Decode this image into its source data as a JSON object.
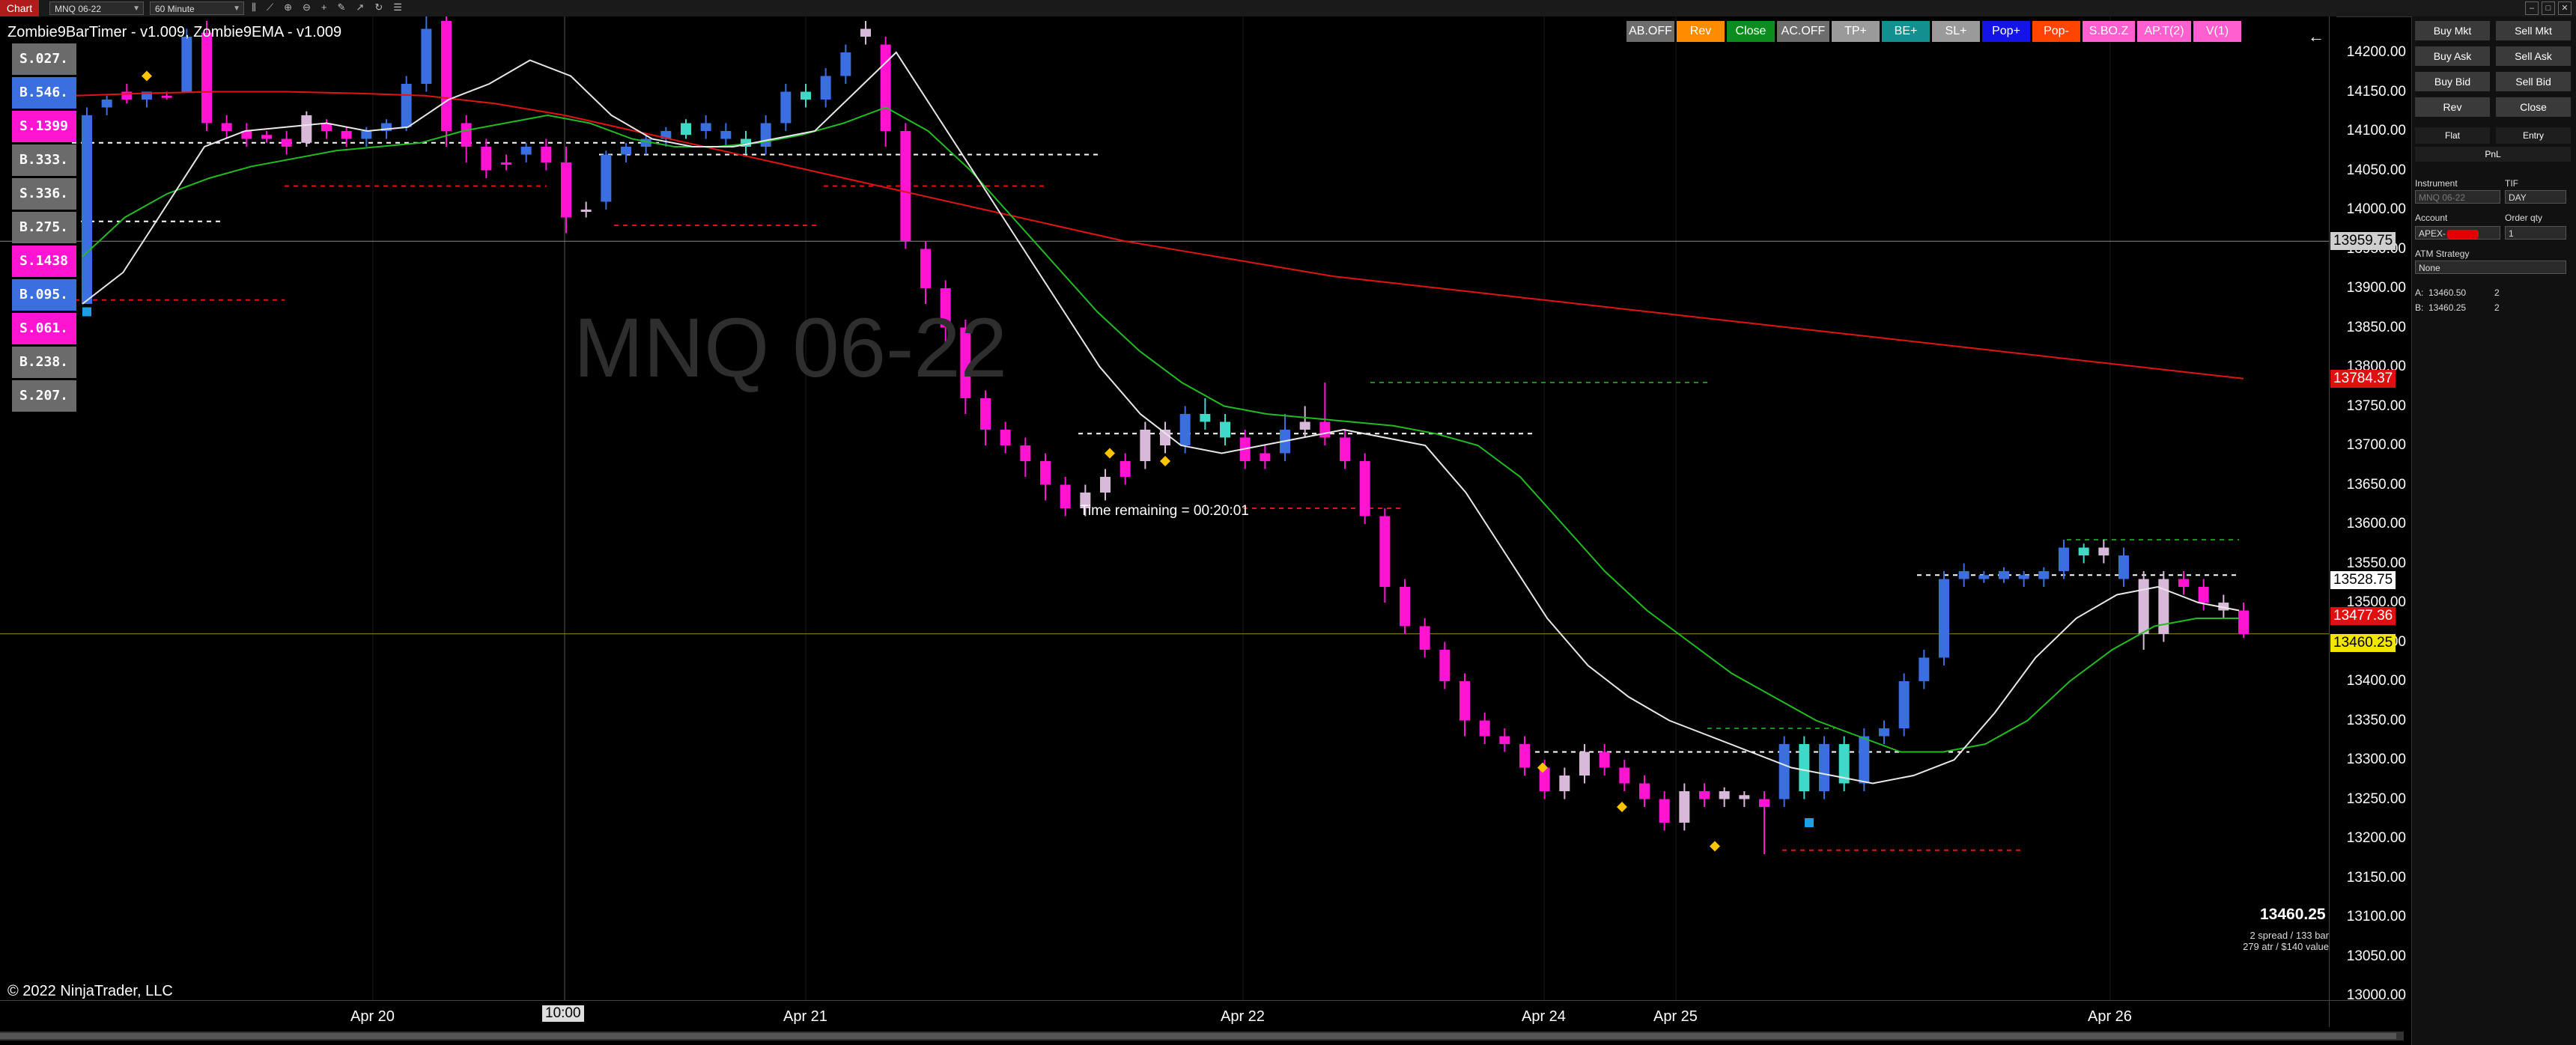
{
  "top_bar": {
    "chart_tab": "Chart",
    "instrument": "MNQ 06-22",
    "interval": "60 Minute",
    "icons": [
      "bar-style-icon",
      "indicators-icon",
      "zoom-icon",
      "magnify-icon",
      "crosshair-icon",
      "drawing-icon",
      "arrow-icon",
      "refresh-icon",
      "properties-icon"
    ]
  },
  "indicator_title": "Zombie9BarTimer - v1.009, Zombie9EMA - v1.009",
  "ladder": [
    {
      "label": "S.027.",
      "color": "#6b6b6b"
    },
    {
      "label": "B.546.",
      "color": "#3b6fe0"
    },
    {
      "label": "S.1399",
      "color": "#ff14d2"
    },
    {
      "label": "B.333.",
      "color": "#6b6b6b"
    },
    {
      "label": "S.336.",
      "color": "#6b6b6b"
    },
    {
      "label": "B.275.",
      "color": "#6b6b6b"
    },
    {
      "label": "S.1438",
      "color": "#ff14d2"
    },
    {
      "label": "B.095.",
      "color": "#3b6fe0"
    },
    {
      "label": "S.061.",
      "color": "#ff14d2"
    },
    {
      "label": "B.238.",
      "color": "#6b6b6b"
    },
    {
      "label": "S.207.",
      "color": "#6b6b6b"
    }
  ],
  "watermark": "MNQ 06-22",
  "time_remaining": "Time remaining = 00:20:01",
  "copyright": "© 2022 NinjaTrader, LLC",
  "chart_buttons": [
    {
      "label": "AB.OFF",
      "color": "#6d6d6d"
    },
    {
      "label": "Rev",
      "color": "#ff8c00"
    },
    {
      "label": "Close",
      "color": "#0c8c1c"
    },
    {
      "label": "AC.OFF",
      "color": "#6d6d6d"
    },
    {
      "label": "TP+",
      "color": "#9a9a9a"
    },
    {
      "label": "BE+",
      "color": "#138f8f"
    },
    {
      "label": "SL+",
      "color": "#9a9a9a"
    },
    {
      "label": "Pop+",
      "color": "#1414e6"
    },
    {
      "label": "Pop-",
      "color": "#ff4500"
    },
    {
      "label": "S.BO.Z",
      "color": "#ff5fcf"
    },
    {
      "label": "AP.T(2)",
      "color": "#ff5fcf"
    },
    {
      "label": "V(1)",
      "color": "#ff5fcf"
    }
  ],
  "price_axis": {
    "ticks": [
      "14200.00",
      "14150.00",
      "14100.00",
      "14050.00",
      "14000.00",
      "13950.00",
      "13900.00",
      "13850.00",
      "13800.00",
      "13750.00",
      "13700.00",
      "13650.00",
      "13600.00",
      "13550.00",
      "13500.00",
      "13450.00",
      "13400.00",
      "13350.00",
      "13300.00",
      "13250.00",
      "13200.00",
      "13150.00",
      "13100.00",
      "13050.00",
      "13000.00"
    ],
    "tags": [
      {
        "value": "13959.75",
        "bg": "#cfcfcf",
        "fg": "#000"
      },
      {
        "value": "13784.37",
        "bg": "#e01010",
        "fg": "#fff"
      },
      {
        "value": "13528.75",
        "bg": "#ffffff",
        "fg": "#000"
      },
      {
        "value": "13477.36",
        "bg": "#e01010",
        "fg": "#fff"
      },
      {
        "value": "13460.25",
        "bg": "#f2e600",
        "fg": "#000"
      }
    ]
  },
  "time_axis": {
    "dates": [
      "Apr 20",
      "Apr 21",
      "Apr 22",
      "Apr 24",
      "Apr 25",
      "Apr 26"
    ],
    "cursor_label": "10:00"
  },
  "last_price": "13460.25",
  "info": {
    "line1": "2 spread / 133 bar",
    "line2": "279 atr / $140 value"
  },
  "right_panel": {
    "buy_mkt": "Buy Mkt",
    "sell_mkt": "Sell Mkt",
    "buy_ask": "Buy Ask",
    "sell_ask": "Sell Ask",
    "buy_bid": "Buy Bid",
    "sell_bid": "Sell Bid",
    "rev": "Rev",
    "close": "Close",
    "flat": "Flat",
    "entry": "Entry",
    "pnl": "PnL",
    "instrument_label": "Instrument",
    "tif_label": "TIF",
    "instrument_value": "MNQ 06-22",
    "tif_value": "DAY",
    "account_label": "Account",
    "order_qty_label": "Order qty",
    "account_value": "APEX-",
    "order_qty_value": "1",
    "atm_label": "ATM Strategy",
    "atm_value": "None",
    "ask_label": "A:",
    "ask_price": "13460.50",
    "ask_size": "2",
    "bid_label": "B:",
    "bid_price": "13460.25",
    "bid_size": "2"
  },
  "chart_data": {
    "type": "candlestick",
    "symbol": "MNQ 06-22",
    "interval": "60 Minute",
    "ylim": [
      13000,
      14200
    ],
    "x_labels": [
      "Apr 20",
      "Apr 21",
      "Apr 22",
      "Apr 24",
      "Apr 25",
      "Apr 26"
    ],
    "candles": [
      [
        13880,
        14120,
        13880,
        14130,
        "#3b6fe0"
      ],
      [
        14130,
        14140,
        14120,
        14145,
        "#3b6fe0"
      ],
      [
        14140,
        14150,
        14135,
        14160,
        "#ff14d2"
      ],
      [
        14150,
        14140,
        14130,
        14150,
        "#3b6fe0"
      ],
      [
        14145,
        14145,
        14140,
        14150,
        "#ff14d2"
      ],
      [
        14150,
        14220,
        14150,
        14230,
        "#3b6fe0"
      ],
      [
        14225,
        14110,
        14100,
        14240,
        "#ff14d2"
      ],
      [
        14110,
        14100,
        14090,
        14120,
        "#ff14d2"
      ],
      [
        14100,
        14090,
        14080,
        14110,
        "#ff14d2"
      ],
      [
        14095,
        14090,
        14085,
        14100,
        "#ff14d2"
      ],
      [
        14090,
        14080,
        14070,
        14100,
        "#ff14d2"
      ],
      [
        14085,
        14120,
        14080,
        14125,
        "#d9b9d9"
      ],
      [
        14110,
        14100,
        14090,
        14115,
        "#ff14d2"
      ],
      [
        14100,
        14090,
        14080,
        14105,
        "#ff14d2"
      ],
      [
        14090,
        14100,
        14080,
        14105,
        "#3b6fe0"
      ],
      [
        14100,
        14110,
        14090,
        14115,
        "#3b6fe0"
      ],
      [
        14105,
        14160,
        14100,
        14170,
        "#3b6fe0"
      ],
      [
        14160,
        14230,
        14150,
        14250,
        "#3b6fe0"
      ],
      [
        14240,
        14100,
        14080,
        14250,
        "#ff14d2"
      ],
      [
        14110,
        14080,
        14060,
        14120,
        "#ff14d2"
      ],
      [
        14080,
        14050,
        14040,
        14090,
        "#ff14d2"
      ],
      [
        14060,
        14060,
        14050,
        14070,
        "#ff14d2"
      ],
      [
        14070,
        14080,
        14060,
        14085,
        "#3b6fe0"
      ],
      [
        14080,
        14060,
        14050,
        14090,
        "#ff14d2"
      ],
      [
        14060,
        13990,
        13970,
        14080,
        "#ff14d2"
      ],
      [
        14000,
        14000,
        13990,
        14010,
        "#d9b9d9"
      ],
      [
        14010,
        14070,
        14000,
        14075,
        "#3b6fe0"
      ],
      [
        14070,
        14080,
        14060,
        14085,
        "#3b6fe0"
      ],
      [
        14080,
        14090,
        14070,
        14095,
        "#3b6fe0"
      ],
      [
        14090,
        14100,
        14080,
        14105,
        "#3b6fe0"
      ],
      [
        14095,
        14110,
        14090,
        14115,
        "#40d9c8"
      ],
      [
        14110,
        14100,
        14090,
        14120,
        "#3b6fe0"
      ],
      [
        14100,
        14090,
        14080,
        14110,
        "#3b6fe0"
      ],
      [
        14090,
        14080,
        14070,
        14100,
        "#40d9c8"
      ],
      [
        14080,
        14110,
        14070,
        14120,
        "#3b6fe0"
      ],
      [
        14110,
        14150,
        14100,
        14160,
        "#3b6fe0"
      ],
      [
        14150,
        14140,
        14130,
        14160,
        "#40d9c8"
      ],
      [
        14140,
        14170,
        14130,
        14180,
        "#3b6fe0"
      ],
      [
        14170,
        14200,
        14160,
        14210,
        "#3b6fe0"
      ],
      [
        14220,
        14230,
        14210,
        14240,
        "#d9b9d9"
      ],
      [
        14210,
        14100,
        14080,
        14220,
        "#ff14d2"
      ],
      [
        14100,
        13960,
        13950,
        14110,
        "#ff14d2"
      ],
      [
        13950,
        13900,
        13880,
        13960,
        "#ff14d2"
      ],
      [
        13900,
        13850,
        13830,
        13910,
        "#ff14d2"
      ],
      [
        13850,
        13760,
        13740,
        13860,
        "#ff14d2"
      ],
      [
        13760,
        13720,
        13700,
        13770,
        "#ff14d2"
      ],
      [
        13720,
        13700,
        13690,
        13730,
        "#ff14d2"
      ],
      [
        13700,
        13680,
        13660,
        13710,
        "#ff14d2"
      ],
      [
        13680,
        13650,
        13630,
        13690,
        "#ff14d2"
      ],
      [
        13650,
        13620,
        13610,
        13660,
        "#ff14d2"
      ],
      [
        13620,
        13640,
        13610,
        13650,
        "#d9b9d9"
      ],
      [
        13640,
        13660,
        13630,
        13670,
        "#d9b9d9"
      ],
      [
        13660,
        13680,
        13650,
        13690,
        "#ff14d2"
      ],
      [
        13680,
        13720,
        13670,
        13730,
        "#d9b9d9"
      ],
      [
        13720,
        13700,
        13690,
        13730,
        "#d9b9d9"
      ],
      [
        13700,
        13740,
        13690,
        13750,
        "#3b6fe0"
      ],
      [
        13740,
        13730,
        13720,
        13760,
        "#40d9c8"
      ],
      [
        13730,
        13710,
        13700,
        13740,
        "#40d9c8"
      ],
      [
        13710,
        13680,
        13670,
        13720,
        "#ff14d2"
      ],
      [
        13680,
        13690,
        13670,
        13700,
        "#ff14d2"
      ],
      [
        13690,
        13720,
        13680,
        13740,
        "#3b6fe0"
      ],
      [
        13720,
        13730,
        13710,
        13750,
        "#d9b9d9"
      ],
      [
        13730,
        13710,
        13700,
        13780,
        "#ff14d2"
      ],
      [
        13710,
        13680,
        13670,
        13720,
        "#ff14d2"
      ],
      [
        13680,
        13610,
        13600,
        13690,
        "#ff14d2"
      ],
      [
        13610,
        13520,
        13500,
        13620,
        "#ff14d2"
      ],
      [
        13520,
        13470,
        13460,
        13530,
        "#ff14d2"
      ],
      [
        13470,
        13440,
        13430,
        13480,
        "#ff14d2"
      ],
      [
        13440,
        13400,
        13390,
        13450,
        "#ff14d2"
      ],
      [
        13400,
        13350,
        13330,
        13410,
        "#ff14d2"
      ],
      [
        13350,
        13330,
        13320,
        13360,
        "#ff14d2"
      ],
      [
        13330,
        13320,
        13310,
        13340,
        "#ff14d2"
      ],
      [
        13320,
        13290,
        13280,
        13330,
        "#ff14d2"
      ],
      [
        13290,
        13260,
        13250,
        13300,
        "#ff14d2"
      ],
      [
        13260,
        13280,
        13250,
        13290,
        "#d9b9d9"
      ],
      [
        13280,
        13310,
        13270,
        13320,
        "#d9b9d9"
      ],
      [
        13310,
        13290,
        13280,
        13320,
        "#ff14d2"
      ],
      [
        13290,
        13270,
        13260,
        13300,
        "#ff14d2"
      ],
      [
        13270,
        13250,
        13240,
        13280,
        "#ff14d2"
      ],
      [
        13250,
        13220,
        13210,
        13260,
        "#ff14d2"
      ],
      [
        13220,
        13260,
        13210,
        13270,
        "#d9b9d9"
      ],
      [
        13260,
        13250,
        13240,
        13270,
        "#ff14d2"
      ],
      [
        13250,
        13260,
        13240,
        13265,
        "#d9b9d9"
      ],
      [
        13255,
        13250,
        13240,
        13260,
        "#d9b9d9"
      ],
      [
        13250,
        13240,
        13180,
        13260,
        "#ff14d2"
      ],
      [
        13250,
        13320,
        13240,
        13330,
        "#3b6fe0"
      ],
      [
        13320,
        13260,
        13250,
        13330,
        "#40d9c8"
      ],
      [
        13260,
        13320,
        13250,
        13330,
        "#3b6fe0"
      ],
      [
        13320,
        13270,
        13260,
        13330,
        "#40d9c8"
      ],
      [
        13270,
        13330,
        13260,
        13340,
        "#3b6fe0"
      ],
      [
        13330,
        13340,
        13320,
        13350,
        "#3b6fe0"
      ],
      [
        13340,
        13400,
        13330,
        13410,
        "#3b6fe0"
      ],
      [
        13400,
        13430,
        13390,
        13440,
        "#3b6fe0"
      ],
      [
        13430,
        13530,
        13420,
        13540,
        "#3b6fe0"
      ],
      [
        13530,
        13540,
        13520,
        13550,
        "#3b6fe0"
      ],
      [
        13530,
        13535,
        13525,
        13540,
        "#3b6fe0"
      ],
      [
        13530,
        13540,
        13525,
        13545,
        "#3b6fe0"
      ],
      [
        13535,
        13530,
        13520,
        13540,
        "#3b6fe0"
      ],
      [
        13530,
        13540,
        13520,
        13545,
        "#3b6fe0"
      ],
      [
        13540,
        13570,
        13530,
        13580,
        "#3b6fe0"
      ],
      [
        13570,
        13560,
        13550,
        13575,
        "#40d9c8"
      ],
      [
        13570,
        13560,
        13550,
        13580,
        "#d9b9d9"
      ],
      [
        13560,
        13530,
        13520,
        13570,
        "#3b6fe0"
      ],
      [
        13530,
        13460,
        13440,
        13540,
        "#d9b9d9"
      ],
      [
        13460,
        13530,
        13450,
        13540,
        "#d9b9d9"
      ],
      [
        13530,
        13520,
        13510,
        13540,
        "#ff14d2"
      ],
      [
        13520,
        13500,
        13490,
        13530,
        "#ff14d2"
      ],
      [
        13500,
        13490,
        13480,
        13510,
        "#d9b9d9"
      ],
      [
        13490,
        13460,
        13455,
        13500,
        "#ff14d2"
      ]
    ],
    "ema_fast_color": "#e8e8e8",
    "ema_mid_color": "#22bb22",
    "ema_slow_color": "#e01414",
    "ema_fast": [
      13880,
      13920,
      14000,
      14080,
      14100,
      14105,
      14110,
      14100,
      14105,
      14140,
      14160,
      14190,
      14170,
      14120,
      14090,
      14080,
      14080,
      14090,
      14100,
      14150,
      14200,
      14120,
      14040,
      13960,
      13880,
      13800,
      13740,
      13700,
      13690,
      13700,
      13710,
      13720,
      13710,
      13700,
      13640,
      13560,
      13480,
      13420,
      13380,
      13350,
      13330,
      13310,
      13290,
      13280,
      13270,
      13280,
      13300,
      13360,
      13430,
      13480,
      13510,
      13520,
      13500,
      13490
    ],
    "ema_mid": [
      13940,
      13990,
      14020,
      14040,
      14055,
      14065,
      14075,
      14080,
      14085,
      14100,
      14110,
      14120,
      14110,
      14090,
      14080,
      14080,
      14085,
      14095,
      14110,
      14130,
      14100,
      14050,
      13990,
      13930,
      13870,
      13820,
      13780,
      13750,
      13740,
      13735,
      13730,
      13725,
      13715,
      13700,
      13660,
      13600,
      13540,
      13490,
      13450,
      13410,
      13380,
      13350,
      13330,
      13310,
      13310,
      13320,
      13350,
      13400,
      13440,
      13470,
      13480,
      13480
    ],
    "ema_slow": [
      14160,
      14158,
      14155,
      14150,
      14148,
      14145,
      14143,
      14140,
      14135,
      14130,
      14125,
      14120,
      14110,
      14100,
      14080,
      14050,
      14010,
      13970,
      13930,
      13890,
      13850,
      13810,
      13770,
      13730,
      13690,
      13650,
      13610,
      13570,
      13540,
      13510,
      13480,
      13460,
      13440,
      13430,
      13420,
      13420,
      13430,
      13440,
      13450,
      13460,
      13470,
      13475
    ],
    "ema_slow_upper": [
      14145,
      14148,
      14150,
      14150,
      14148,
      14145,
      14135,
      14120,
      14100,
      14080,
      14060,
      14040,
      14020,
      14000,
      13980,
      13960,
      13945,
      13930,
      13915,
      13905,
      13895,
      13885,
      13875,
      13865,
      13855,
      13845,
      13835,
      13825,
      13815,
      13805,
      13795,
      13785
    ]
  }
}
